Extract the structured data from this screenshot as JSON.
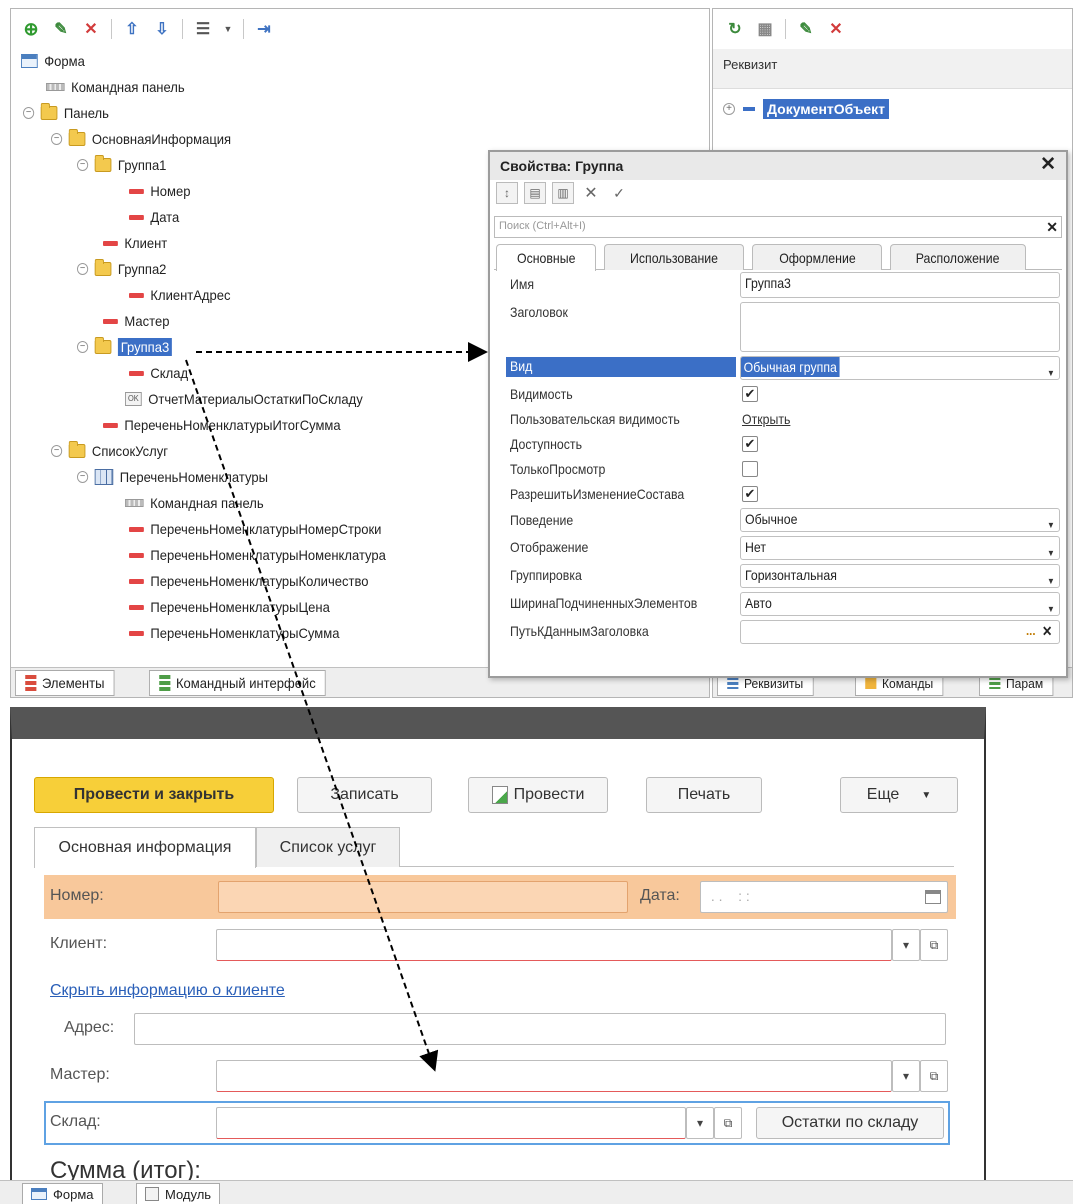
{
  "tree": {
    "toolbar_icons": [
      "add-icon",
      "edit-icon",
      "delete-icon",
      "move-up-icon",
      "move-down-icon",
      "list-view-icon",
      "dropdown-icon",
      "export-icon"
    ],
    "items": [
      {
        "label": "Форма",
        "icon": "form-icon"
      },
      {
        "label": "Командная панель",
        "icon": "command-bar-icon"
      },
      {
        "label": "Панель",
        "icon": "folder-icon"
      },
      {
        "label": "ОсновнаяИнформация",
        "icon": "folder-icon"
      },
      {
        "label": "Группа1",
        "icon": "folder-icon"
      },
      {
        "label": "Номер",
        "icon": "field-icon"
      },
      {
        "label": "Дата",
        "icon": "field-icon"
      },
      {
        "label": "Клиент",
        "icon": "field-icon"
      },
      {
        "label": "Группа2",
        "icon": "folder-icon"
      },
      {
        "label": "КлиентАдрес",
        "icon": "field-icon"
      },
      {
        "label": "Мастер",
        "icon": "field-icon"
      },
      {
        "label": "Группа3",
        "icon": "folder-icon"
      },
      {
        "label": "Склад",
        "icon": "field-icon"
      },
      {
        "label": "ОтчетМатериалыОстаткиПоСкладу",
        "icon": "ok-button-icon"
      },
      {
        "label": "ПереченьНоменклатурыИтогСумма",
        "icon": "field-icon"
      },
      {
        "label": "СписокУслуг",
        "icon": "folder-icon"
      },
      {
        "label": "ПереченьНоменклатуры",
        "icon": "table-icon"
      },
      {
        "label": "Командная панель",
        "icon": "command-bar-icon"
      },
      {
        "label": "ПереченьНоменклатурыНомерСтроки",
        "icon": "field-icon"
      },
      {
        "label": "ПереченьНоменклатурыНоменклатура",
        "icon": "field-icon"
      },
      {
        "label": "ПереченьНоменклатурыКоличество",
        "icon": "field-icon"
      },
      {
        "label": "ПереченьНоменклатурыЦена",
        "icon": "field-icon"
      },
      {
        "label": "ПереченьНоменклатурыСумма",
        "icon": "field-icon"
      }
    ],
    "bottom_tabs": [
      "Элементы",
      "Командный интерфейс"
    ]
  },
  "attributes": {
    "toolbar_icons": [
      "add-attribute-icon",
      "grid-icon",
      "edit-icon",
      "delete-icon"
    ],
    "header": "Реквизит",
    "item": "ДокументОбъект",
    "bottom_tabs": [
      "Реквизиты",
      "Команды",
      "Парам"
    ]
  },
  "props": {
    "title": "Свойства: Группа",
    "search_placeholder": "Поиск (Ctrl+Alt+I)",
    "tabs": [
      "Основные",
      "Использование",
      "Оформление",
      "Расположение"
    ],
    "rows": {
      "name_label": "Имя",
      "name_value": "Группа3",
      "caption_label": "Заголовок",
      "caption_value": "",
      "kind_label": "Вид",
      "kind_value": "Обычная группа",
      "visible_label": "Видимость",
      "visible_checked": true,
      "user_visibility_label": "Пользовательская видимость",
      "user_visibility_link": "Открыть",
      "enabled_label": "Доступность",
      "enabled_checked": true,
      "readonly_label": "ТолькоПросмотр",
      "readonly_checked": false,
      "allow_change_label": "РазрешитьИзменениеСостава",
      "allow_change_checked": true,
      "behavior_label": "Поведение",
      "behavior_value": "Обычное",
      "display_label": "Отображение",
      "display_value": "Нет",
      "grouping_label": "Группировка",
      "grouping_value": "Горизонтальная",
      "width_label": "ШиринаПодчиненныхЭлементов",
      "width_value": "Авто",
      "path_label": "ПутьКДаннымЗаголовка",
      "path_value": "",
      "path_btn": "...",
      "path_clear": "✕"
    },
    "check_mark": "✔"
  },
  "runtime": {
    "buttons": {
      "post_close": "Провести и закрыть",
      "save": "Записать",
      "post": "Провести",
      "print": "Печать",
      "more": "Еще"
    },
    "tabs": [
      "Основная информация",
      "Список услуг"
    ],
    "labels": {
      "number": "Номер:",
      "date": "Дата:",
      "client": "Клиент:",
      "address": "Адрес:",
      "master": "Мастер:",
      "warehouse": "Склад:"
    },
    "date_placeholder": " . .    : :",
    "hide_client_link": "Скрыть информацию о клиенте",
    "stock_button": "Остатки по складу",
    "sum_label": "Сумма (итог):"
  },
  "status_bar": {
    "tabs": [
      "Форма",
      "Модуль"
    ]
  }
}
